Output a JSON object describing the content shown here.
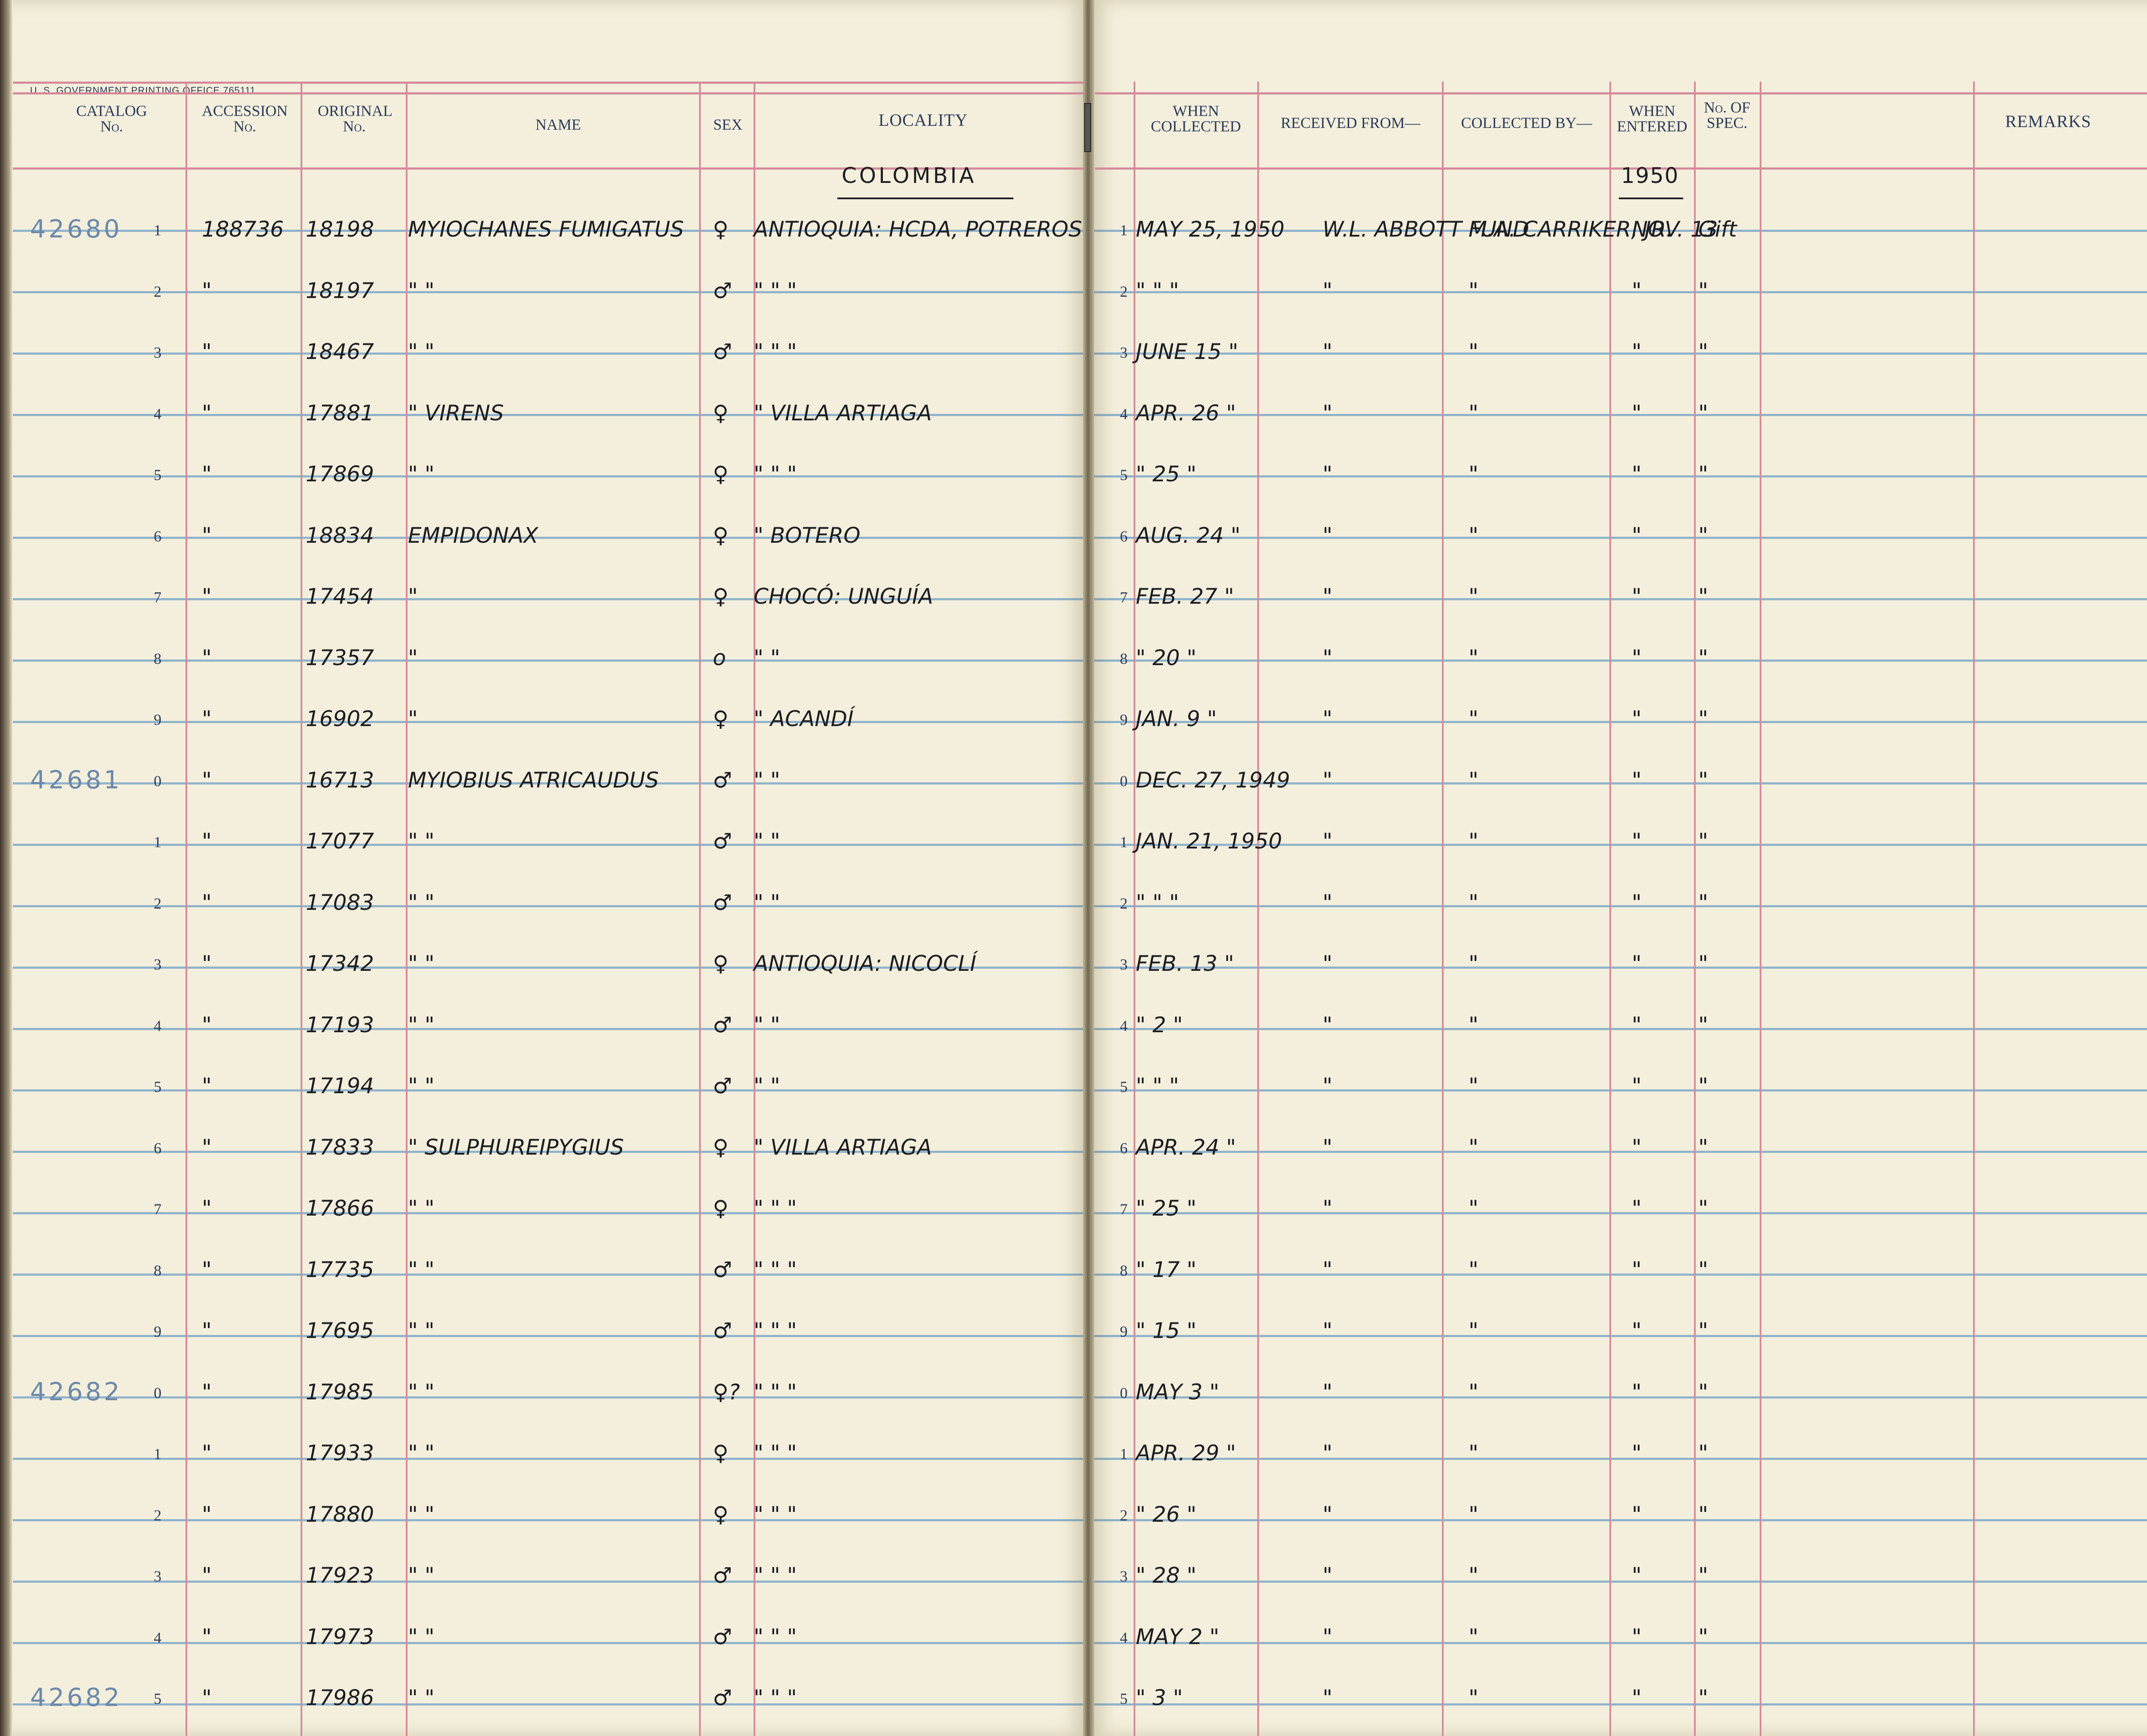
{
  "printer_line": "U. S. GOVERNMENT PRINTING OFFICE  765111",
  "headers": {
    "catalog": "CATALOG No.",
    "accession": "ACCESSION No.",
    "original": "ORIGINAL No.",
    "name": "NAME",
    "sex": "SEX",
    "locality": "LOCALITY",
    "when_collected": "WHEN COLLECTED",
    "received_from": "RECEIVED FROM—",
    "collected_by": "COLLECTED BY—",
    "when_entered": "WHEN ENTERED",
    "no_of_spec": "No. OF SPEC.",
    "remarks": "REMARKS"
  },
  "country": "COLOMBIA",
  "year_entered": "1950",
  "rows": [
    {
      "cat": "42680",
      "d": "1",
      "acc": "188736",
      "orig": "18198",
      "name": "MYIOCHANES FUMIGATUS",
      "sex": "♀",
      "loc": "ANTIOQUIA: HCDA, POTREROS",
      "rd": "1",
      "when": "MAY 25, 1950",
      "recv": "W.L. ABBOTT FUND",
      "coll": "M.A. CARRIKER, JR.",
      "ent": "NOV. 13",
      "spec": "Gift"
    },
    {
      "cat": "",
      "d": "2",
      "acc": "\"",
      "orig": "18197",
      "name": "\"          \"",
      "sex": "♂",
      "loc": "\"        \"        \"",
      "rd": "2",
      "when": "\"  \"  \"",
      "recv": "\"",
      "coll": "\"",
      "ent": "\"",
      "spec": "\""
    },
    {
      "cat": "",
      "d": "3",
      "acc": "\"",
      "orig": "18467",
      "name": "\"          \"",
      "sex": "♂",
      "loc": "\"        \"        \"",
      "rd": "3",
      "when": "JUNE 15 \"",
      "recv": "\"",
      "coll": "\"",
      "ent": "\"",
      "spec": "\""
    },
    {
      "cat": "",
      "d": "4",
      "acc": "\"",
      "orig": "17881",
      "name": "\"      VIRENS",
      "sex": "♀",
      "loc": "\"    VILLA ARTIAGA",
      "rd": "4",
      "when": "APR. 26 \"",
      "recv": "\"",
      "coll": "\"",
      "ent": "\"",
      "spec": "\""
    },
    {
      "cat": "",
      "d": "5",
      "acc": "\"",
      "orig": "17869",
      "name": "\"          \"",
      "sex": "♀",
      "loc": "\"        \"        \"",
      "rd": "5",
      "when": "\" 25 \"",
      "recv": "\"",
      "coll": "\"",
      "ent": "\"",
      "spec": "\""
    },
    {
      "cat": "",
      "d": "6",
      "acc": "\"",
      "orig": "18834",
      "name": "EMPIDONAX",
      "sex": "♀",
      "loc": "\"     BOTERO",
      "rd": "6",
      "when": "AUG. 24 \"",
      "recv": "\"",
      "coll": "\"",
      "ent": "\"",
      "spec": "\""
    },
    {
      "cat": "",
      "d": "7",
      "acc": "\"",
      "orig": "17454",
      "name": "\"",
      "sex": "♀",
      "loc": "CHOCÓ: UNGUÍA",
      "rd": "7",
      "when": "FEB. 27 \"",
      "recv": "\"",
      "coll": "\"",
      "ent": "\"",
      "spec": "\""
    },
    {
      "cat": "",
      "d": "8",
      "acc": "\"",
      "orig": "17357",
      "name": "\"",
      "sex": "o",
      "loc": "\"        \"",
      "rd": "8",
      "when": "\" 20 \"",
      "recv": "\"",
      "coll": "\"",
      "ent": "\"",
      "spec": "\""
    },
    {
      "cat": "",
      "d": "9",
      "acc": "\"",
      "orig": "16902",
      "name": "\"",
      "sex": "♀",
      "loc": "\"      ACANDÍ",
      "rd": "9",
      "when": "JAN. 9 \"",
      "recv": "\"",
      "coll": "\"",
      "ent": "\"",
      "spec": "\""
    },
    {
      "cat": "42681",
      "d": "0",
      "acc": "\"",
      "orig": "16713",
      "name": "MYIOBIUS ATRICAUDUS",
      "sex": "♂",
      "loc": "\"        \"",
      "rd": "0",
      "when": "DEC. 27, 1949",
      "recv": "\"",
      "coll": "\"",
      "ent": "\"",
      "spec": "\""
    },
    {
      "cat": "",
      "d": "1",
      "acc": "\"",
      "orig": "17077",
      "name": "\"      \"",
      "sex": "♂",
      "loc": "\"        \"",
      "rd": "1",
      "when": "JAN. 21, 1950",
      "recv": "\"",
      "coll": "\"",
      "ent": "\"",
      "spec": "\""
    },
    {
      "cat": "",
      "d": "2",
      "acc": "\"",
      "orig": "17083",
      "name": "\"      \"",
      "sex": "♂",
      "loc": "\"        \"",
      "rd": "2",
      "when": "\"  \"  \"",
      "recv": "\"",
      "coll": "\"",
      "ent": "\"",
      "spec": "\""
    },
    {
      "cat": "",
      "d": "3",
      "acc": "\"",
      "orig": "17342",
      "name": "\"      \"",
      "sex": "♀",
      "loc": "ANTIOQUIA: NICOCLÍ",
      "rd": "3",
      "when": "FEB. 13 \"",
      "recv": "\"",
      "coll": "\"",
      "ent": "\"",
      "spec": "\""
    },
    {
      "cat": "",
      "d": "4",
      "acc": "\"",
      "orig": "17193",
      "name": "\"      \"",
      "sex": "♂",
      "loc": "\"        \"",
      "rd": "4",
      "when": "\" 2 \"",
      "recv": "\"",
      "coll": "\"",
      "ent": "\"",
      "spec": "\""
    },
    {
      "cat": "",
      "d": "5",
      "acc": "\"",
      "orig": "17194",
      "name": "\"      \"",
      "sex": "♂",
      "loc": "\"        \"",
      "rd": "5",
      "when": "\"  \"  \"",
      "recv": "\"",
      "coll": "\"",
      "ent": "\"",
      "spec": "\""
    },
    {
      "cat": "",
      "d": "6",
      "acc": "\"",
      "orig": "17833",
      "name": "\"  SULPHUREIPYGIUS",
      "sex": "♀",
      "loc": "\"    VILLA ARTIAGA",
      "rd": "6",
      "when": "APR. 24 \"",
      "recv": "\"",
      "coll": "\"",
      "ent": "\"",
      "spec": "\""
    },
    {
      "cat": "",
      "d": "7",
      "acc": "\"",
      "orig": "17866",
      "name": "\"      \"",
      "sex": "♀",
      "loc": "\"        \"        \"",
      "rd": "7",
      "when": "\" 25 \"",
      "recv": "\"",
      "coll": "\"",
      "ent": "\"",
      "spec": "\""
    },
    {
      "cat": "",
      "d": "8",
      "acc": "\"",
      "orig": "17735",
      "name": "\"      \"",
      "sex": "♂",
      "loc": "\"        \"        \"",
      "rd": "8",
      "when": "\" 17 \"",
      "recv": "\"",
      "coll": "\"",
      "ent": "\"",
      "spec": "\""
    },
    {
      "cat": "",
      "d": "9",
      "acc": "\"",
      "orig": "17695",
      "name": "\"      \"",
      "sex": "♂",
      "loc": "\"        \"        \"",
      "rd": "9",
      "when": "\" 15 \"",
      "recv": "\"",
      "coll": "\"",
      "ent": "\"",
      "spec": "\""
    },
    {
      "cat": "42682",
      "d": "0",
      "acc": "\"",
      "orig": "17985",
      "name": "\"      \"",
      "sex": "♀?",
      "loc": "\"        \"        \"",
      "rd": "0",
      "when": "MAY 3 \"",
      "recv": "\"",
      "coll": "\"",
      "ent": "\"",
      "spec": "\""
    },
    {
      "cat": "",
      "d": "1",
      "acc": "\"",
      "orig": "17933",
      "name": "\"      \"",
      "sex": "♀",
      "loc": "\"        \"        \"",
      "rd": "1",
      "when": "APR. 29 \"",
      "recv": "\"",
      "coll": "\"",
      "ent": "\"",
      "spec": "\""
    },
    {
      "cat": "",
      "d": "2",
      "acc": "\"",
      "orig": "17880",
      "name": "\"      \"",
      "sex": "♀",
      "loc": "\"        \"        \"",
      "rd": "2",
      "when": "\" 26 \"",
      "recv": "\"",
      "coll": "\"",
      "ent": "\"",
      "spec": "\""
    },
    {
      "cat": "",
      "d": "3",
      "acc": "\"",
      "orig": "17923",
      "name": "\"      \"",
      "sex": "♂",
      "loc": "\"        \"        \"",
      "rd": "3",
      "when": "\" 28 \"",
      "recv": "\"",
      "coll": "\"",
      "ent": "\"",
      "spec": "\""
    },
    {
      "cat": "",
      "d": "4",
      "acc": "\"",
      "orig": "17973",
      "name": "\"      \"",
      "sex": "♂",
      "loc": "\"        \"        \"",
      "rd": "4",
      "when": "MAY 2 \"",
      "recv": "\"",
      "coll": "\"",
      "ent": "\"",
      "spec": "\""
    },
    {
      "cat": "42682",
      "d": "5",
      "acc": "\"",
      "orig": "17986",
      "name": "\"      \"",
      "sex": "♂",
      "loc": "\"        \"        \"",
      "rd": "5",
      "when": "\" 3 \"",
      "recv": "\"",
      "coll": "\"",
      "ent": "\"",
      "spec": "\""
    }
  ]
}
